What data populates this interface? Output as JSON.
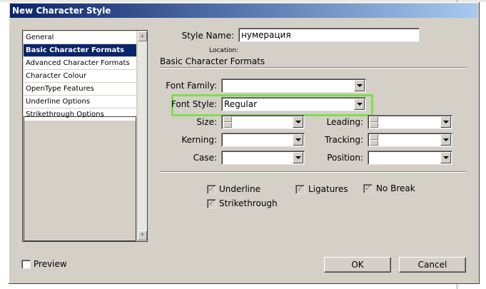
{
  "window": {
    "title": "New Character Style"
  },
  "sidebar": {
    "items": [
      {
        "label": "General"
      },
      {
        "label": "Basic Character Formats"
      },
      {
        "label": "Advanced Character Formats"
      },
      {
        "label": "Character Colour"
      },
      {
        "label": "OpenType Features"
      },
      {
        "label": "Underline Options"
      },
      {
        "label": "Strikethrough Options"
      }
    ],
    "selected_index": 1
  },
  "style_name": {
    "label": "Style Name:",
    "value": "нумерация"
  },
  "location": {
    "label": "Location:"
  },
  "section": {
    "title": "Basic Character Formats"
  },
  "fields": {
    "font_family": {
      "label": "Font Family:",
      "value": ""
    },
    "font_style": {
      "label": "Font Style:",
      "value": "Regular"
    },
    "size": {
      "label": "Size:",
      "value": ""
    },
    "leading": {
      "label": "Leading:",
      "value": ""
    },
    "kerning": {
      "label": "Kerning:",
      "value": ""
    },
    "tracking": {
      "label": "Tracking:",
      "value": ""
    },
    "case": {
      "label": "Case:",
      "value": ""
    },
    "position": {
      "label": "Position:",
      "value": ""
    }
  },
  "checkboxes": {
    "underline": {
      "label": "Underline",
      "checked": true
    },
    "ligatures": {
      "label": "Ligatures",
      "checked": true
    },
    "no_break": {
      "label": "No Break",
      "checked": true
    },
    "strikethrough": {
      "label": "Strikethrough",
      "checked": true
    }
  },
  "preview": {
    "label": "Preview",
    "checked": false
  },
  "buttons": {
    "ok": "OK",
    "cancel": "Cancel"
  },
  "colors": {
    "highlight": "#7ee04a",
    "title_start": "#0a246a",
    "title_end": "#a6caf0",
    "dialog_bg": "#d4d0c8"
  }
}
